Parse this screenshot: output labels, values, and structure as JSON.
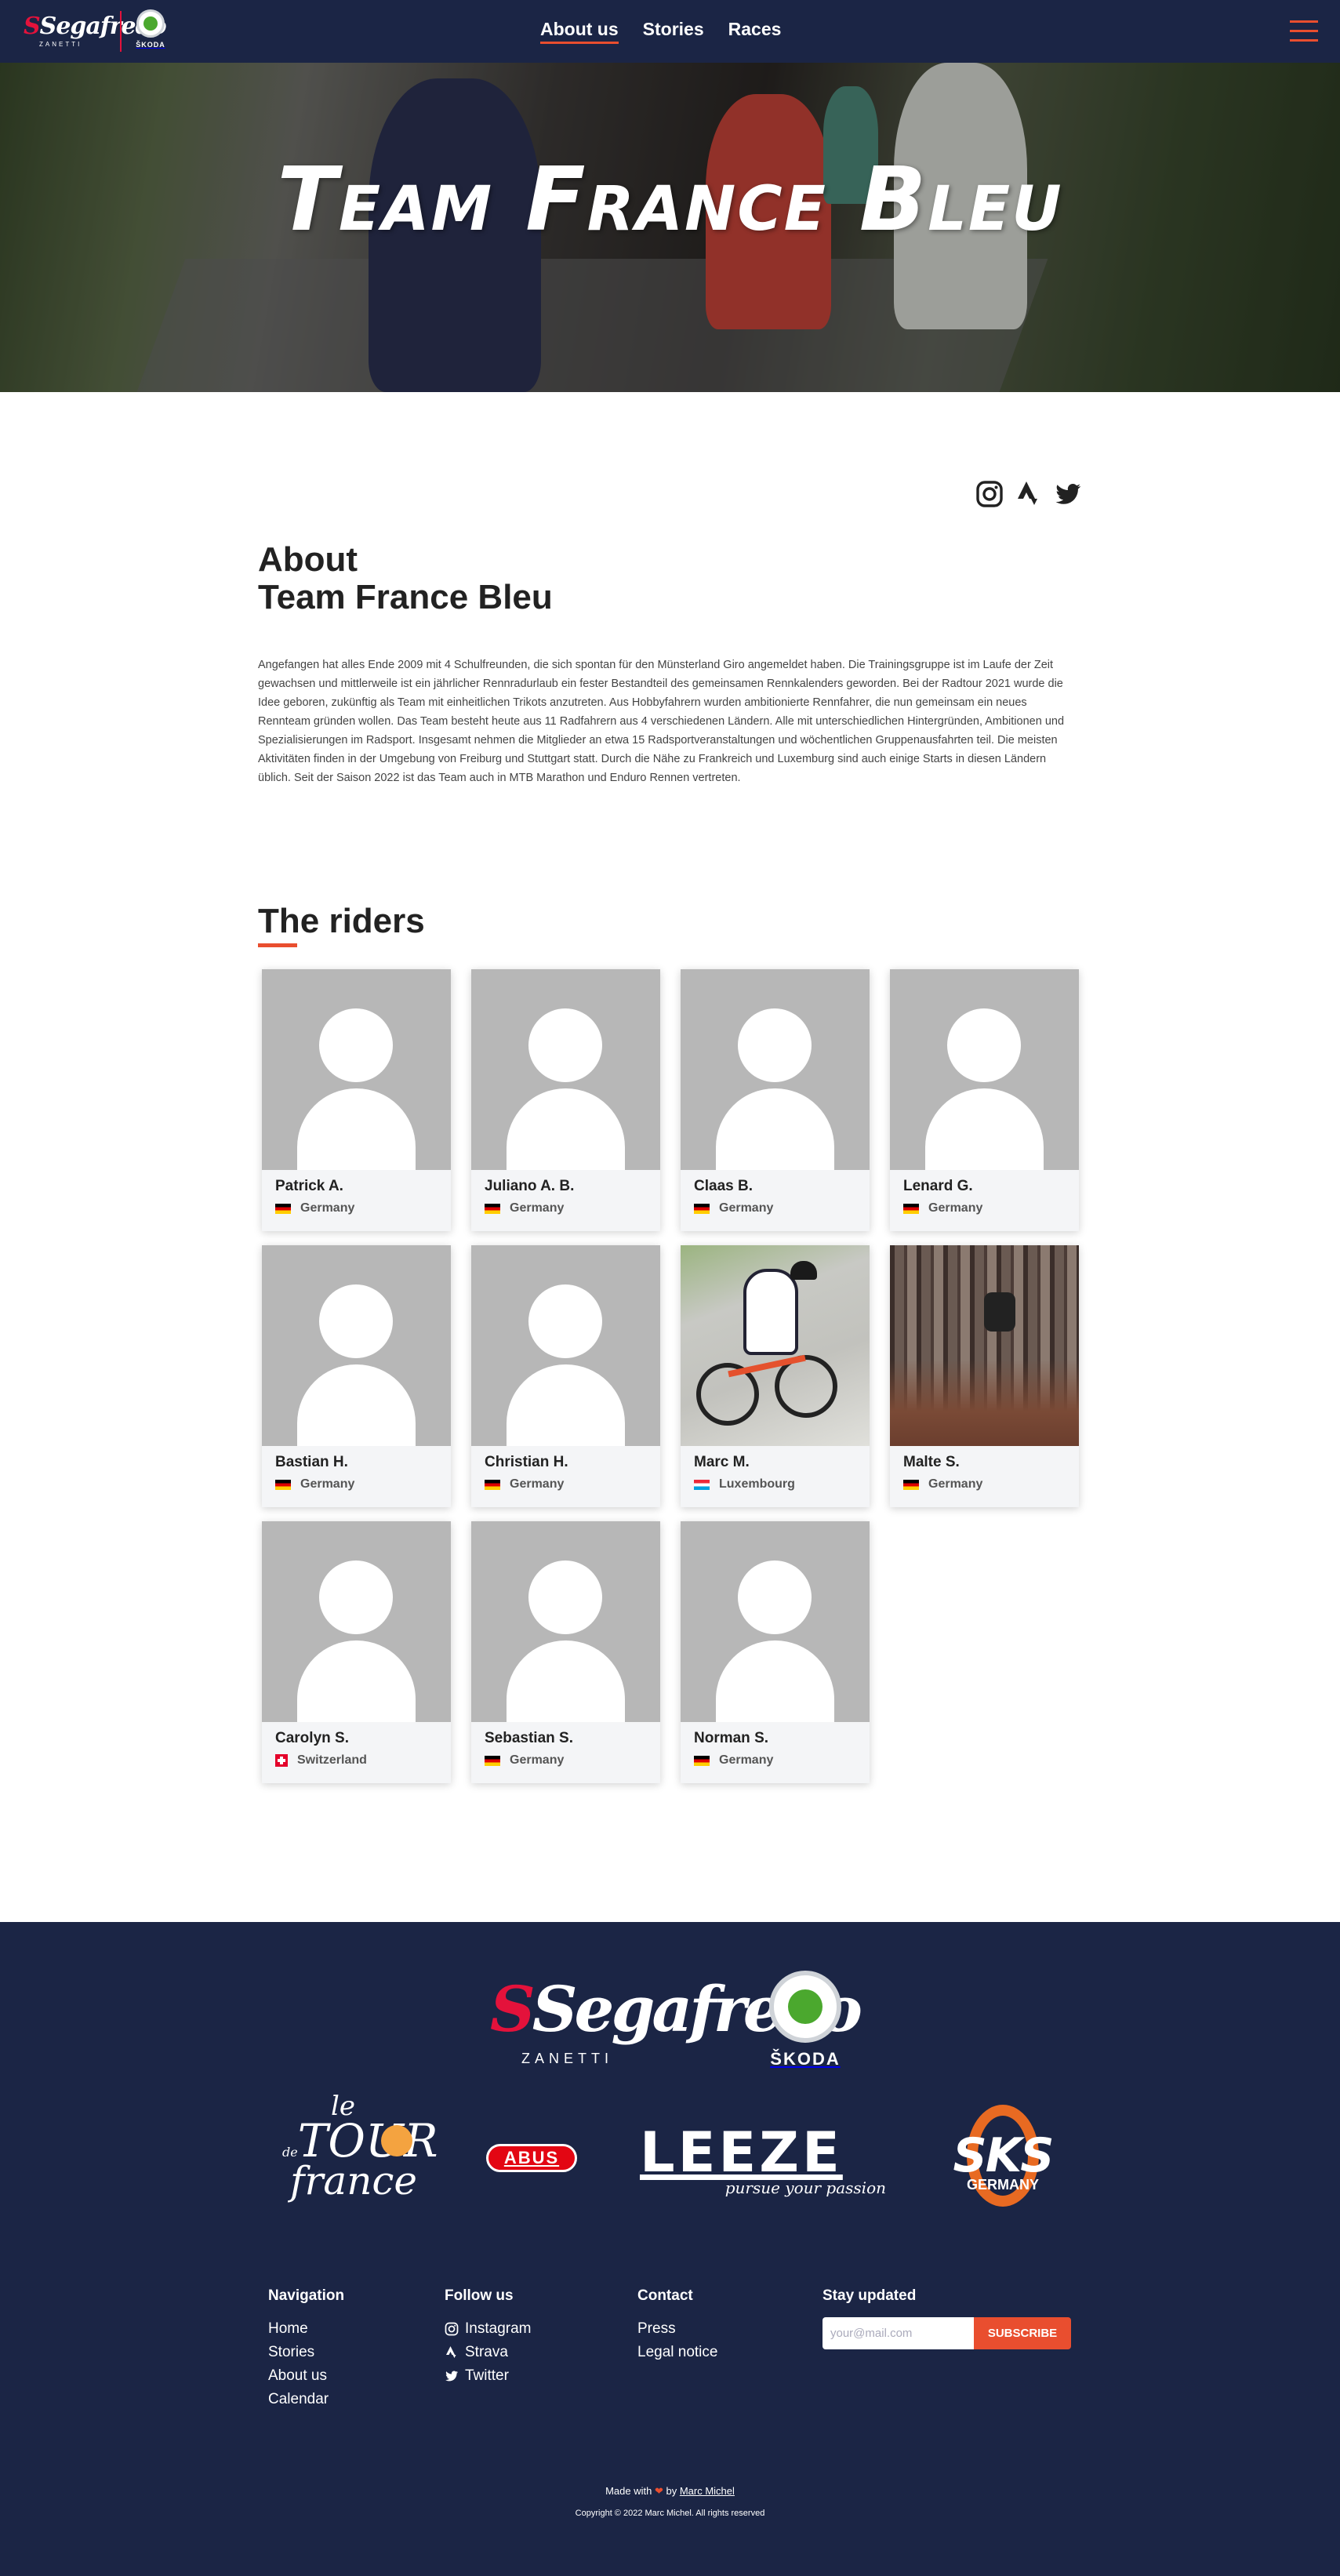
{
  "header": {
    "brand_main": "Segafredo",
    "brand_sub": "ZANETTI",
    "skoda_label": "ŠKODA",
    "nav": [
      {
        "label": "About us",
        "active": true
      },
      {
        "label": "Stories",
        "active": false
      },
      {
        "label": "Races",
        "active": false
      }
    ],
    "menu_icon": "hamburger-icon"
  },
  "hero": {
    "title": "Team France Bleu"
  },
  "social_icons": [
    "instagram-icon",
    "strava-icon",
    "twitter-icon"
  ],
  "about": {
    "title_line1": "About",
    "title_line2": "Team France Bleu",
    "text": "Angefangen hat alles Ende 2009 mit 4 Schulfreunden, die sich spontan für den Münsterland Giro angemeldet haben. Die Trainingsgruppe ist im Laufe der Zeit gewachsen und mittlerweile ist ein jährlicher Rennradurlaub ein fester Bestandteil des gemeinsamen Rennkalenders geworden. Bei der Radtour 2021 wurde die Idee geboren, zukünftig als Team mit einheitlichen Trikots anzutreten. Aus Hobbyfahrern wurden ambitionierte Rennfahrer, die nun gemeinsam ein neues Rennteam gründen wollen. Das Team besteht heute aus 11 Radfahrern aus 4 verschiedenen Ländern. Alle mit unterschiedlichen Hintergründen, Ambitionen und Spezialisierungen im Radsport. Insgesamt nehmen die Mitglieder an etwa 15 Radsportveranstaltungen und wöchentlichen Gruppenausfahrten teil. Die meisten Aktivitäten finden in der Umgebung von Freiburg und Stuttgart statt. Durch die Nähe zu Frankreich und Luxemburg sind auch einige Starts in diesen Ländern üblich. Seit der Saison 2022 ist das Team auch in MTB Marathon und Enduro Rennen vertreten."
  },
  "riders": {
    "title": "The riders",
    "items": [
      {
        "name": "Patrick A.",
        "country": "Germany",
        "flag": "de",
        "photo": "placeholder"
      },
      {
        "name": "Juliano A. B.",
        "country": "Germany",
        "flag": "de",
        "photo": "placeholder"
      },
      {
        "name": "Claas B.",
        "country": "Germany",
        "flag": "de",
        "photo": "placeholder"
      },
      {
        "name": "Lenard G.",
        "country": "Germany",
        "flag": "de",
        "photo": "placeholder"
      },
      {
        "name": "Bastian H.",
        "country": "Germany",
        "flag": "de",
        "photo": "placeholder"
      },
      {
        "name": "Christian H.",
        "country": "Germany",
        "flag": "de",
        "photo": "placeholder"
      },
      {
        "name": "Marc M.",
        "country": "Luxembourg",
        "flag": "lu",
        "photo": "cyclist"
      },
      {
        "name": "Malte S.",
        "country": "Germany",
        "flag": "de",
        "photo": "forest"
      },
      {
        "name": "Carolyn S.",
        "country": "Switzerland",
        "flag": "ch",
        "photo": "placeholder"
      },
      {
        "name": "Sebastian S.",
        "country": "Germany",
        "flag": "de",
        "photo": "placeholder"
      },
      {
        "name": "Norman S.",
        "country": "Germany",
        "flag": "de",
        "photo": "placeholder"
      }
    ]
  },
  "footer": {
    "sponsor_main": {
      "brand": "Segafredo",
      "sub": "ZANETTI"
    },
    "sponsor_skoda": "ŠKODA",
    "sponsors": {
      "tdf": {
        "le": "le",
        "tour": "TOUR",
        "de": "de",
        "france": "france"
      },
      "abus": "ABUS",
      "leeze": {
        "word": "LEEZE",
        "slogan": "pursue your passion"
      },
      "sks": {
        "word": "SKS",
        "sub": "GERMANY"
      }
    },
    "navigation": {
      "title": "Navigation",
      "links": [
        "Home",
        "Stories",
        "About us",
        "Calendar"
      ]
    },
    "follow": {
      "title": "Follow us",
      "links": [
        {
          "label": "Instagram",
          "icon": "instagram-icon"
        },
        {
          "label": "Strava",
          "icon": "strava-icon"
        },
        {
          "label": "Twitter",
          "icon": "twitter-icon"
        }
      ]
    },
    "contact": {
      "title": "Contact",
      "links": [
        "Press",
        "Legal notice"
      ]
    },
    "newsletter": {
      "title": "Stay updated",
      "placeholder": "your@mail.com",
      "button": "SUBSCRIBE"
    },
    "made_with": "Made with",
    "by": "by",
    "author": "Marc Michel",
    "copyright": "Copyright © 2022 Marc Michel. All rights reserved"
  },
  "colors": {
    "navy": "#1b2545",
    "accent": "#e94e2f",
    "card_bg": "#f4f5f7",
    "placeholder_gray": "#b7b7b7"
  }
}
